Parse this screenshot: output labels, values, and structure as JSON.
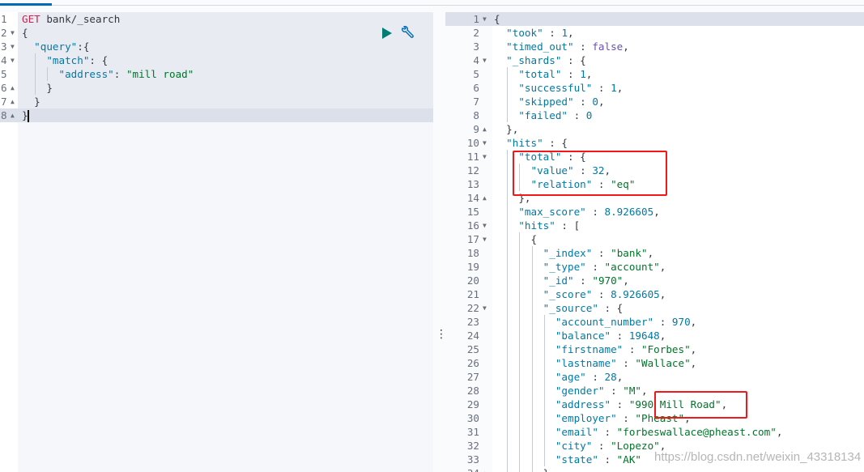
{
  "request_pane": {
    "run_icon": "play-icon",
    "settings_icon": "wrench-icon",
    "lines": [
      {
        "n": "1",
        "text": "GET bank/_search"
      },
      {
        "n": "2",
        "fold": "open",
        "text": "{"
      },
      {
        "n": "3",
        "fold": "open",
        "text": "  \"query\":{"
      },
      {
        "n": "4",
        "fold": "open",
        "text": "    \"match\": {"
      },
      {
        "n": "5",
        "text": "      \"address\": \"mill road\""
      },
      {
        "n": "6",
        "fold": "close",
        "text": "    }"
      },
      {
        "n": "7",
        "fold": "close",
        "text": "  }"
      },
      {
        "n": "8",
        "fold": "close",
        "text": "}",
        "active": true
      }
    ]
  },
  "response_pane": {
    "lines": [
      {
        "n": "1",
        "fold": "open",
        "text": "{",
        "active": true
      },
      {
        "n": "2",
        "text": "  \"took\" : 1,"
      },
      {
        "n": "3",
        "text": "  \"timed_out\" : false,"
      },
      {
        "n": "4",
        "fold": "open",
        "text": "  \"_shards\" : {"
      },
      {
        "n": "5",
        "text": "    \"total\" : 1,"
      },
      {
        "n": "6",
        "text": "    \"successful\" : 1,"
      },
      {
        "n": "7",
        "text": "    \"skipped\" : 0,"
      },
      {
        "n": "8",
        "text": "    \"failed\" : 0"
      },
      {
        "n": "9",
        "fold": "close",
        "text": "  },"
      },
      {
        "n": "10",
        "fold": "open",
        "text": "  \"hits\" : {"
      },
      {
        "n": "11",
        "fold": "open",
        "text": "    \"total\" : {"
      },
      {
        "n": "12",
        "text": "      \"value\" : 32,"
      },
      {
        "n": "13",
        "text": "      \"relation\" : \"eq\""
      },
      {
        "n": "14",
        "fold": "close",
        "text": "    },"
      },
      {
        "n": "15",
        "text": "    \"max_score\" : 8.926605,"
      },
      {
        "n": "16",
        "fold": "open",
        "text": "    \"hits\" : ["
      },
      {
        "n": "17",
        "fold": "open",
        "text": "      {"
      },
      {
        "n": "18",
        "text": "        \"_index\" : \"bank\","
      },
      {
        "n": "19",
        "text": "        \"_type\" : \"account\","
      },
      {
        "n": "20",
        "text": "        \"_id\" : \"970\","
      },
      {
        "n": "21",
        "text": "        \"_score\" : 8.926605,"
      },
      {
        "n": "22",
        "fold": "open",
        "text": "        \"_source\" : {"
      },
      {
        "n": "23",
        "text": "          \"account_number\" : 970,"
      },
      {
        "n": "24",
        "text": "          \"balance\" : 19648,"
      },
      {
        "n": "25",
        "text": "          \"firstname\" : \"Forbes\","
      },
      {
        "n": "26",
        "text": "          \"lastname\" : \"Wallace\","
      },
      {
        "n": "27",
        "text": "          \"age\" : 28,"
      },
      {
        "n": "28",
        "text": "          \"gender\" : \"M\","
      },
      {
        "n": "29",
        "text": "          \"address\" : \"990 Mill Road\","
      },
      {
        "n": "30",
        "text": "          \"employer\" : \"Pheast\","
      },
      {
        "n": "31",
        "text": "          \"email\" : \"forbeswallace@pheast.com\","
      },
      {
        "n": "32",
        "text": "          \"city\" : \"Lopezo\","
      },
      {
        "n": "33",
        "text": "          \"state\" : \"AK\""
      },
      {
        "n": "34",
        "fold": "close",
        "text": "        }"
      }
    ]
  },
  "annotation_color": "#f01818",
  "watermark": "https://blog.csdn.net/weixin_43318134"
}
